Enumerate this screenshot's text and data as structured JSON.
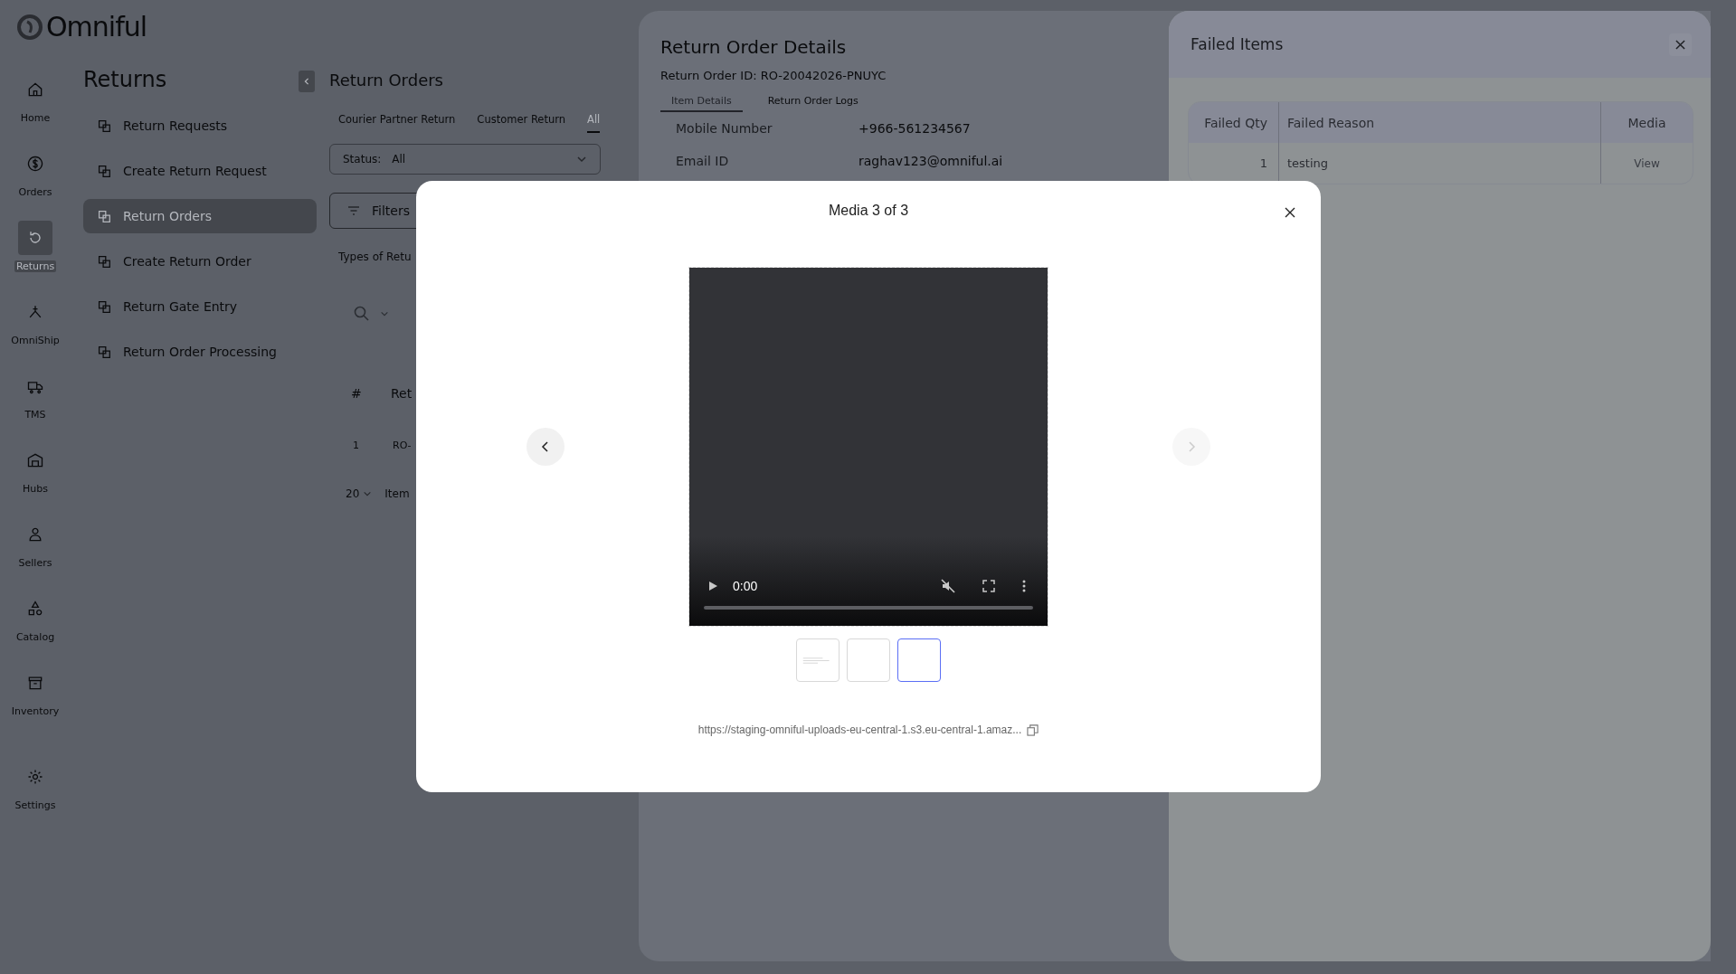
{
  "logo": {
    "text": "Omniful"
  },
  "rail": [
    {
      "label": "Home",
      "selected": false
    },
    {
      "label": "Orders",
      "selected": false
    },
    {
      "label": "Returns",
      "selected": true
    },
    {
      "label": "OmniShip",
      "selected": false
    },
    {
      "label": "TMS",
      "selected": false
    },
    {
      "label": "Hubs",
      "selected": false
    },
    {
      "label": "Sellers",
      "selected": false
    },
    {
      "label": "Catalog",
      "selected": false
    },
    {
      "label": "Inventory",
      "selected": false
    },
    {
      "label": "Settings",
      "selected": false
    }
  ],
  "submenu": {
    "title": "Returns",
    "items": [
      {
        "label": "Return Requests",
        "selected": false
      },
      {
        "label": "Create Return Request",
        "selected": false
      },
      {
        "label": "Return Orders",
        "selected": true
      },
      {
        "label": "Create Return Order",
        "selected": false
      },
      {
        "label": "Return Gate Entry",
        "selected": false
      },
      {
        "label": "Return Order Processing",
        "selected": false
      }
    ]
  },
  "main": {
    "title": "Return Orders",
    "tabs": [
      {
        "label": "Courier Partner Return",
        "selected": false
      },
      {
        "label": "Customer Return",
        "selected": false
      },
      {
        "label": "All",
        "selected": true
      }
    ],
    "status_filter": {
      "label": "Status:",
      "value": "All"
    },
    "filters_button": "Filters",
    "types_label": "Types of Retu",
    "table": {
      "columns": [
        "#",
        "Ret"
      ],
      "rows": [
        [
          "1",
          "RO-"
        ]
      ]
    },
    "page_size": "20",
    "items_label": "Item"
  },
  "details": {
    "title": "Return Order Details",
    "subtitle": "Return Order ID: RO-20042026-PNUYC",
    "tabs": [
      {
        "label": "Item Details",
        "selected": true
      },
      {
        "label": "Return Order Logs",
        "selected": false
      }
    ],
    "fields": [
      {
        "label": "Mobile Number",
        "value": "+966-561234567"
      },
      {
        "label": "Email ID",
        "value": "raghav123@omniful.ai"
      }
    ]
  },
  "failed_items": {
    "title": "Failed Items",
    "columns": [
      "Failed Qty",
      "Failed Reason",
      "Media"
    ],
    "rows": [
      {
        "qty": "1",
        "reason": "testing",
        "media": "View"
      }
    ]
  },
  "media_modal": {
    "title": "Media 3 of 3",
    "video": {
      "time": "0:00",
      "muted": true
    },
    "prev_enabled": true,
    "next_enabled": false,
    "thumbnails": [
      {
        "kind": "document",
        "selected": false
      },
      {
        "kind": "blank",
        "selected": false
      },
      {
        "kind": "blank",
        "selected": true
      }
    ],
    "url": "https://staging-omniful-uploads-eu-central-1.s3.eu-central-1.amaz..."
  }
}
